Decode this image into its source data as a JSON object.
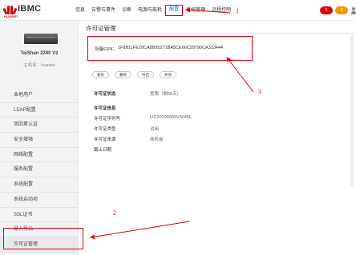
{
  "brand": {
    "logo_text": "IBMC",
    "logo_sub": "HUAWEI"
  },
  "nav": [
    {
      "label": "信息"
    },
    {
      "label": "告警与事件"
    },
    {
      "label": "诊断"
    },
    {
      "label": "电源与能耗"
    },
    {
      "label": "配置",
      "active": true
    },
    {
      "label": "系统管理"
    },
    {
      "label": "远程控制"
    }
  ],
  "alerts": {
    "critical": "0",
    "warning": "0"
  },
  "server": {
    "model": "TaiShan 2280 V2",
    "host": "主机名：huawei"
  },
  "sidebar": {
    "items": [
      {
        "label": "本地用户"
      },
      {
        "label": "LDAP配置"
      },
      {
        "label": "双因素认证"
      },
      {
        "label": "安全增强"
      },
      {
        "label": "网络配置"
      },
      {
        "label": "服务配置"
      },
      {
        "label": "系统配置"
      },
      {
        "label": "系统启动项"
      },
      {
        "label": "SSL证书"
      },
      {
        "label": "导入导出"
      },
      {
        "label": "许可证管理",
        "active": true
      }
    ]
  },
  "main": {
    "title": "许可证管理",
    "esn_label": "设备ESN：",
    "esn_value": "1F8B11FE20CA8B95271BA5CE66C28790CA333444",
    "buttons": [
      "安装",
      "删除",
      "导出",
      "失效"
    ],
    "license_status_label": "许可证状态",
    "license_status_value": "宽限（剩55天）",
    "license_info_title": "许可证信息",
    "rows": [
      {
        "label": "许可证序列号",
        "value": "LIC20190609V5045L"
      },
      {
        "label": "许可证类型",
        "value": "试用"
      },
      {
        "label": "许可证来源",
        "value": "商机板"
      },
      {
        "label": "截止日期",
        "value": ""
      }
    ]
  },
  "annotations": [
    "1",
    "2",
    "3"
  ],
  "colors": {
    "accent": "#e60012",
    "link_blue": "#1e63c4",
    "sidebar_bg": "#f2f3f5"
  }
}
